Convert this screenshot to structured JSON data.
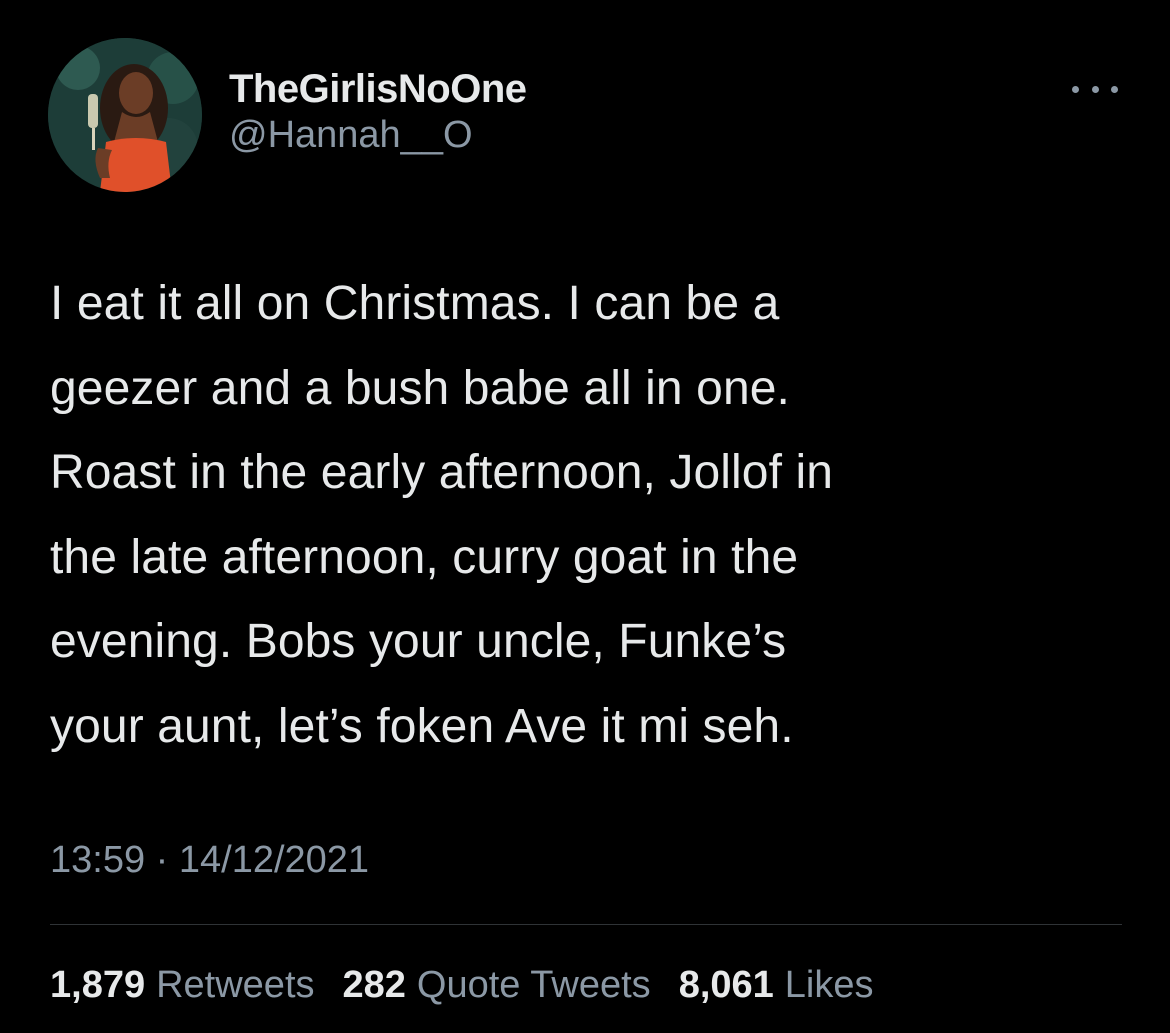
{
  "author": {
    "display_name": "TheGirlisNoOne",
    "handle": "@Hannah__O"
  },
  "tweet": {
    "text": "I eat it all on Christmas. I can be a\ngeezer and a bush babe all in one.\nRoast in the early afternoon, Jollof in\nthe late afternoon, curry goat in the\nevening. Bobs your uncle, Funke’s\nyour aunt, let’s foken Ave it mi seh.",
    "time": "13:59",
    "separator": "·",
    "date": "14/12/2021"
  },
  "stats": {
    "retweets_count": "1,879",
    "retweets_label": "Retweets",
    "quotes_count": "282",
    "quotes_label": "Quote Tweets",
    "likes_count": "8,061",
    "likes_label": "Likes"
  },
  "icons": {
    "more": "more-horizontal-icon"
  },
  "colors": {
    "background": "#000000",
    "primary_text": "#e7e9ea",
    "secondary_text": "#8b98a5",
    "divider": "#2f3336"
  }
}
